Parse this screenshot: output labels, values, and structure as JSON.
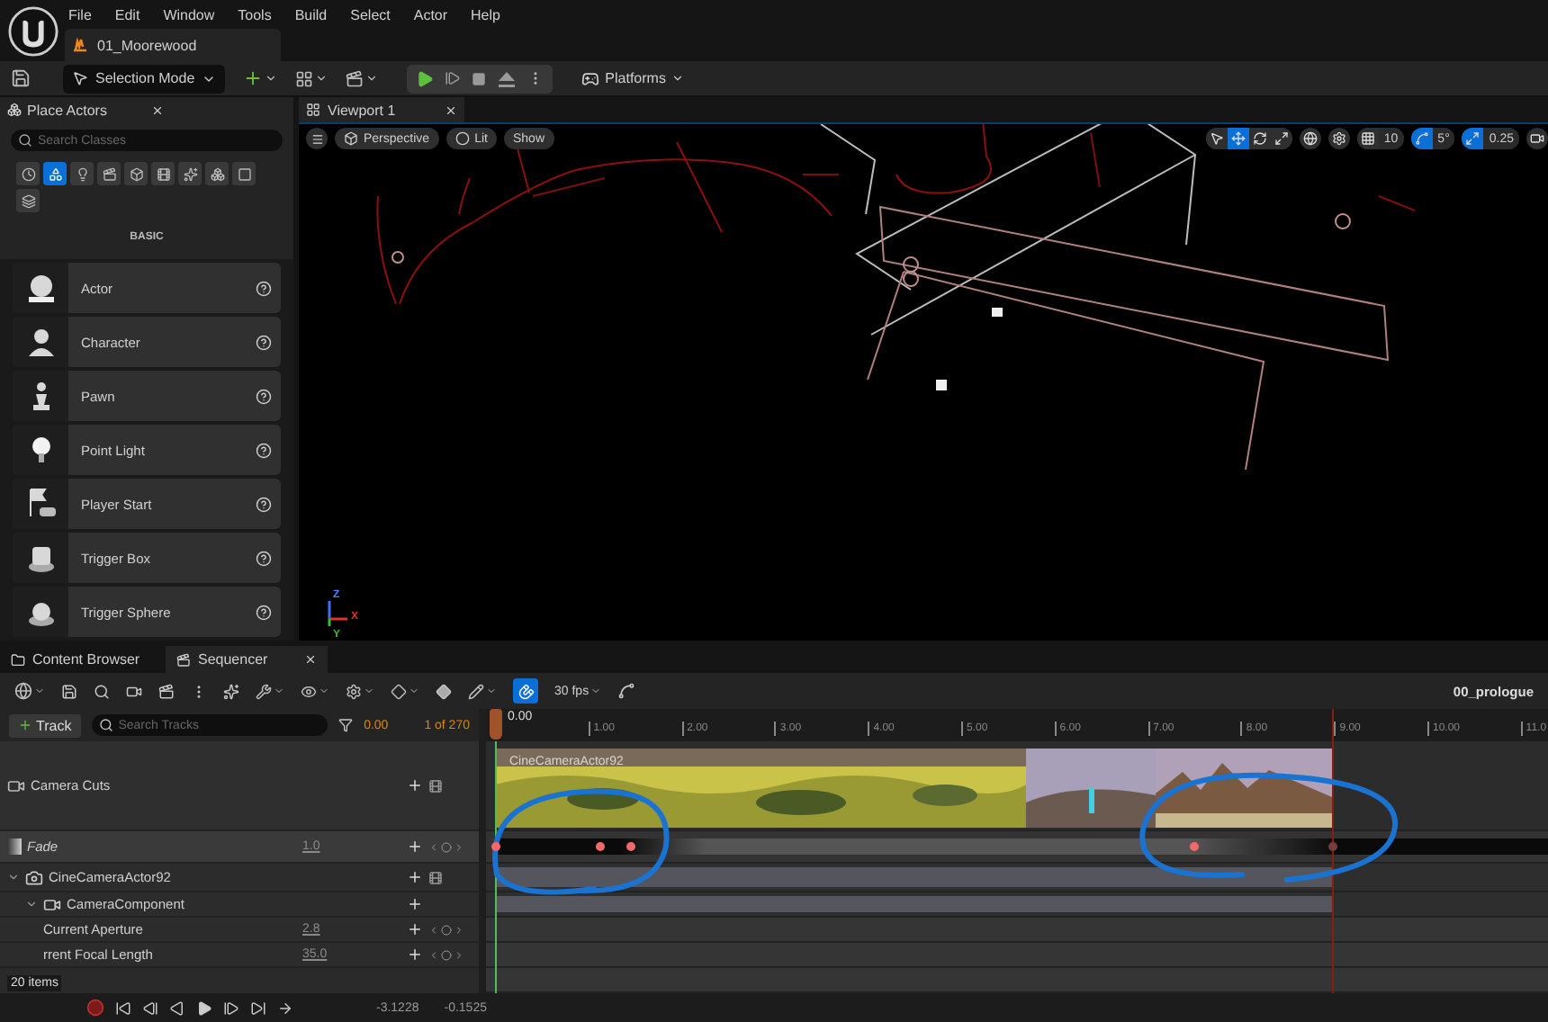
{
  "menu": [
    "File",
    "Edit",
    "Window",
    "Tools",
    "Build",
    "Select",
    "Actor",
    "Help"
  ],
  "level_tab": {
    "label": "01_Moorewood"
  },
  "toolbar": {
    "mode": "Selection Mode",
    "platforms": "Platforms"
  },
  "place_actors": {
    "title": "Place Actors",
    "search": {
      "placeholder": "Search Classes"
    },
    "categories": [
      {
        "selected": false
      },
      {
        "selected": true
      },
      {
        "selected": false
      },
      {
        "selected": false
      },
      {
        "selected": false
      },
      {
        "selected": false
      },
      {
        "selected": false
      },
      {
        "selected": false
      },
      {
        "selected": false
      },
      {
        "selected": false
      }
    ],
    "section": "BASIC",
    "actors": [
      {
        "label": "Actor"
      },
      {
        "label": "Character"
      },
      {
        "label": "Pawn"
      },
      {
        "label": "Point Light"
      },
      {
        "label": "Player Start"
      },
      {
        "label": "Trigger Box"
      },
      {
        "label": "Trigger Sphere"
      }
    ]
  },
  "viewport": {
    "title": "Viewport 1",
    "view_buttons": [
      "Perspective",
      "Lit",
      "Show"
    ],
    "transform_tools": [
      {
        "selected": false
      },
      {
        "selected": true
      },
      {
        "selected": false
      },
      {
        "selected": false
      }
    ],
    "snaps": [
      {
        "kind": "grid",
        "value": "10",
        "on": false
      },
      {
        "kind": "angle",
        "value": "5°",
        "on": true
      },
      {
        "kind": "scale",
        "value": "0.25",
        "on": true
      }
    ],
    "axes": [
      "Z",
      "X",
      "Y"
    ]
  },
  "bottom_tabs": [
    {
      "label": "Content Browser",
      "selected": false
    },
    {
      "label": "Sequencer",
      "selected": true
    }
  ],
  "sequencer": {
    "fps": "30 fps",
    "snap": true,
    "sequence": "00_prologue",
    "add_track": "Track",
    "search": {
      "placeholder": "Search Tracks"
    },
    "current_time": "0.00",
    "frame": "1 of 270",
    "playhead": "0.00",
    "ruler": [
      "1.00",
      "2.00",
      "3.00",
      "4.00",
      "5.00",
      "6.00",
      "7.00",
      "8.00",
      "9.00",
      "10.00",
      "11.0"
    ],
    "clip_label": "CineCameraActor92",
    "tracks": [
      {
        "kind": "camera_cuts",
        "label": "Camera Cuts"
      },
      {
        "kind": "fade",
        "label": "Fade",
        "value": "1.0"
      },
      {
        "kind": "actor",
        "label": "CineCameraActor92",
        "expanded": true,
        "children": [
          {
            "kind": "component",
            "label": "CameraComponent",
            "expanded": true,
            "children": [
              {
                "kind": "property",
                "label": "Current Aperture",
                "value": "2.8"
              },
              {
                "kind": "property",
                "label": "rrent Focal Length",
                "value": "35.0"
              }
            ]
          }
        ]
      }
    ],
    "readouts": [
      "-3.1228",
      "-0.1525"
    ]
  },
  "content_browser": {
    "item_count": "20 items"
  }
}
